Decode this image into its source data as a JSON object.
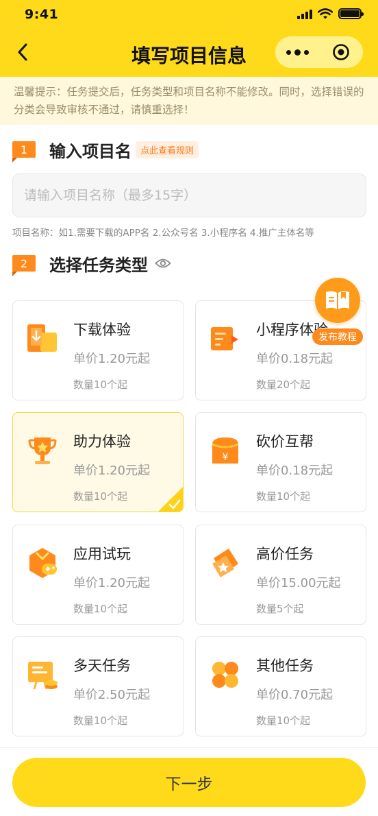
{
  "status_bar": {
    "time": "9:41"
  },
  "nav": {
    "title": "填写项目信息"
  },
  "notice": {
    "text": "温馨提示：任务提交后，任务类型和项目名称不能修改。同时，选择错误的分类会导致审核不通过，请慎重选择！"
  },
  "section1": {
    "number": "1",
    "title": "输入项目名",
    "rule_link": "点此查看规则",
    "input_placeholder": "请输入项目名称（最多15字）",
    "hint": "项目名称：如1.需要下载的APP名 2.公众号名 3.小程序名 4.推广主体名等"
  },
  "section2": {
    "number": "2",
    "title": "选择任务类型"
  },
  "tutorial": {
    "label": "发布教程"
  },
  "task_types": [
    {
      "name": "下载体验",
      "price": "单价1.20元起",
      "qty": "数量10个起",
      "icon": "download-phone-icon",
      "selected": false
    },
    {
      "name": "小程序体验",
      "price": "单价0.18元起",
      "qty": "数量20个起",
      "icon": "mini-program-icon",
      "selected": false
    },
    {
      "name": "助力体验",
      "price": "单价1.20元起",
      "qty": "数量10个起",
      "icon": "trophy-icon",
      "selected": true
    },
    {
      "name": "砍价互帮",
      "price": "单价0.18元起",
      "qty": "数量10个起",
      "icon": "price-bag-icon",
      "selected": false
    },
    {
      "name": "应用试玩",
      "price": "单价1.20元起",
      "qty": "数量10个起",
      "icon": "game-controller-icon",
      "selected": false
    },
    {
      "name": "高价任务",
      "price": "单价15.00元起",
      "qty": "数量5个起",
      "icon": "premium-tag-icon",
      "selected": false
    },
    {
      "name": "多天任务",
      "price": "单价2.50元起",
      "qty": "数量10个起",
      "icon": "calendar-board-icon",
      "selected": false
    },
    {
      "name": "其他任务",
      "price": "单价0.70元起",
      "qty": "数量10个起",
      "icon": "four-petal-icon",
      "selected": false
    }
  ],
  "next_button": "下一步",
  "colors": {
    "brand_yellow": "#FFDA1A",
    "accent_orange": "#FF8A1C",
    "notice_bg": "#FFF8DD"
  }
}
